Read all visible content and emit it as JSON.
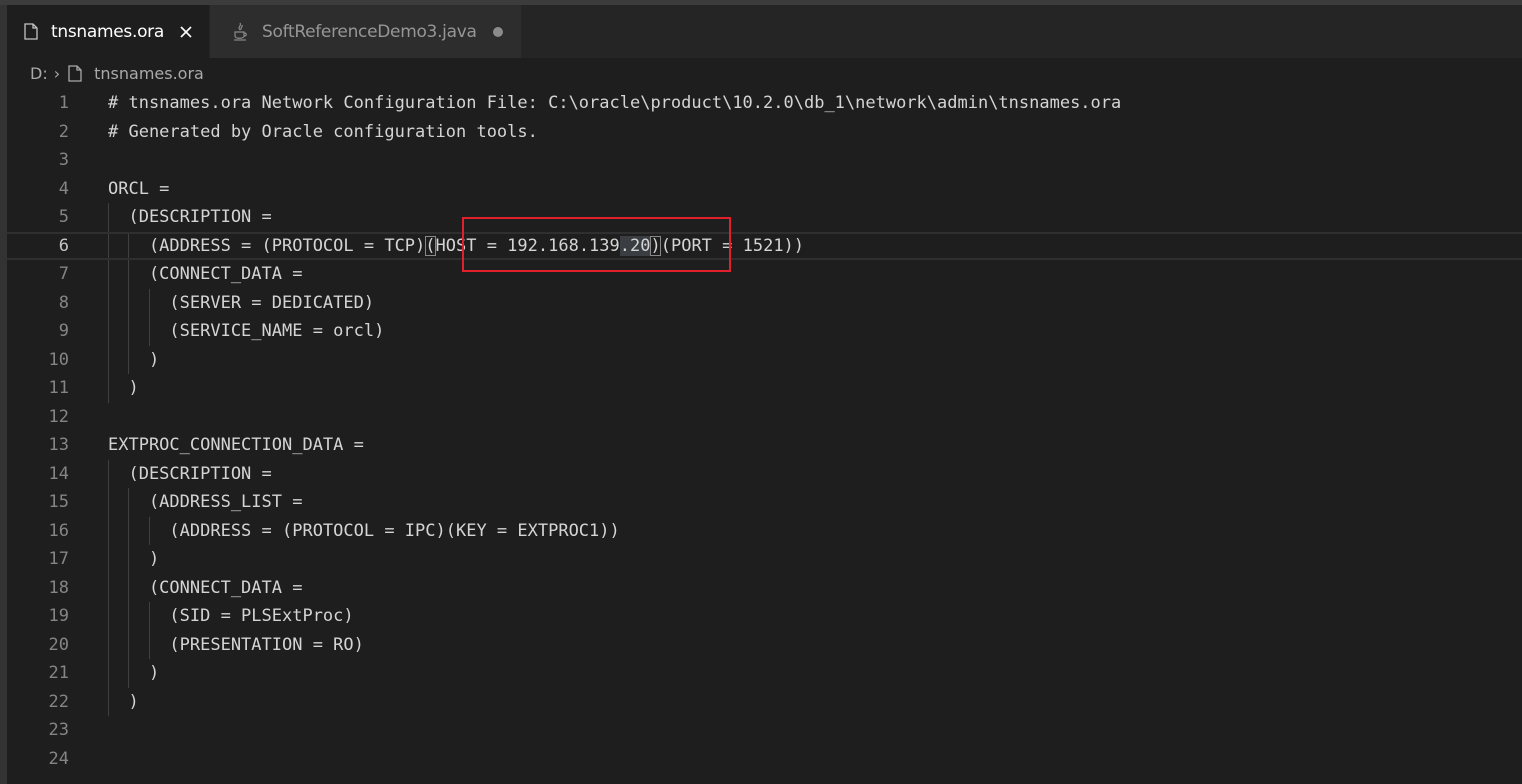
{
  "tabs": [
    {
      "label": "tnsnames.ora",
      "active": true,
      "icon": "file-icon",
      "action_icon": "close-icon"
    },
    {
      "label": "SoftReferenceDemo3.java",
      "active": false,
      "icon": "java-icon",
      "action_icon": "unsaved-dot-icon"
    }
  ],
  "breadcrumb": {
    "drive": "D:",
    "file": "tnsnames.ora"
  },
  "editor": {
    "current_line": 6,
    "lines": [
      {
        "n": "1",
        "text": "# tnsnames.ora Network Configuration File: C:\\oracle\\product\\10.2.0\\db_1\\network\\admin\\tnsnames.ora"
      },
      {
        "n": "2",
        "text": "# Generated by Oracle configuration tools."
      },
      {
        "n": "3",
        "text": ""
      },
      {
        "n": "4",
        "text": "ORCL ="
      },
      {
        "n": "5",
        "text": "  (DESCRIPTION ="
      },
      {
        "n": "6",
        "text": "    (ADDRESS = (PROTOCOL = TCP)(HOST = 192.168.139.20)(PORT = 1521))"
      },
      {
        "n": "7",
        "text": "    (CONNECT_DATA ="
      },
      {
        "n": "8",
        "text": "      (SERVER = DEDICATED)"
      },
      {
        "n": "9",
        "text": "      (SERVICE_NAME = orcl)"
      },
      {
        "n": "10",
        "text": "    )"
      },
      {
        "n": "11",
        "text": "  )"
      },
      {
        "n": "12",
        "text": ""
      },
      {
        "n": "13",
        "text": "EXTPROC_CONNECTION_DATA ="
      },
      {
        "n": "14",
        "text": "  (DESCRIPTION ="
      },
      {
        "n": "15",
        "text": "    (ADDRESS_LIST ="
      },
      {
        "n": "16",
        "text": "      (ADDRESS = (PROTOCOL = IPC)(KEY = EXTPROC1))"
      },
      {
        "n": "17",
        "text": "    )"
      },
      {
        "n": "18",
        "text": "    (CONNECT_DATA ="
      },
      {
        "n": "19",
        "text": "      (SID = PLSExtProc)"
      },
      {
        "n": "20",
        "text": "      (PRESENTATION = RO)"
      },
      {
        "n": "21",
        "text": "    )"
      },
      {
        "n": "22",
        "text": "  )"
      },
      {
        "n": "23",
        "text": ""
      },
      {
        "n": "24",
        "text": ""
      }
    ],
    "line6_parts": {
      "before": "    (ADDRESS = (PROTOCOL = TCP)",
      "host_open": "(",
      "host_text": "HOST = 192.168.139",
      "host_selected": ".20",
      "host_close": ")",
      "after": "(PORT = 1521))"
    }
  },
  "colors": {
    "background": "#1e1e1e",
    "text": "#d4d4d4",
    "annotation": "#e0202a"
  }
}
